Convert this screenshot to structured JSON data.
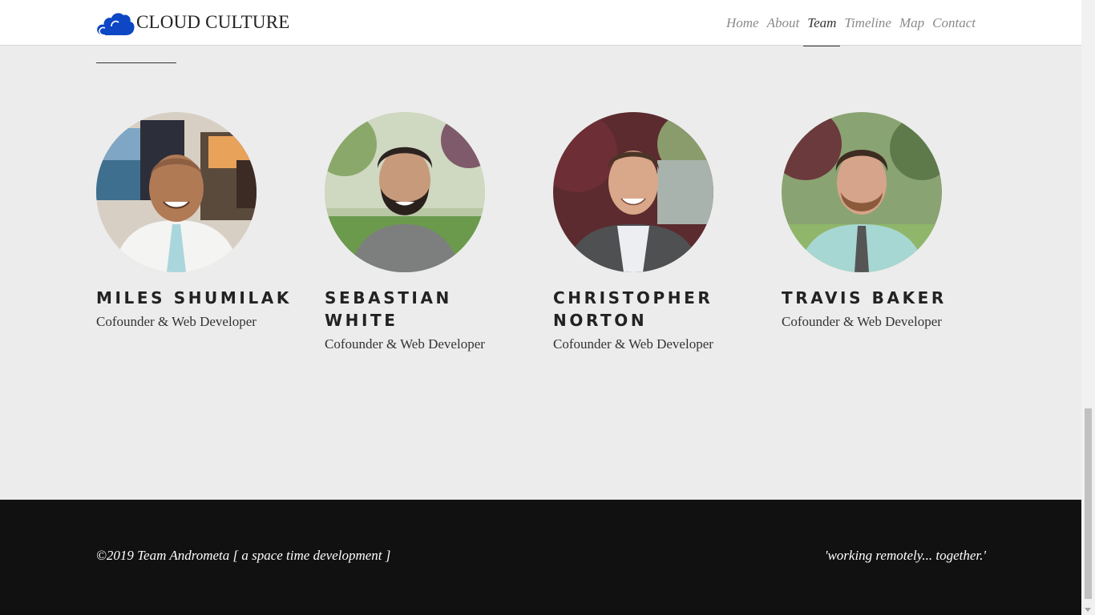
{
  "brand": {
    "name": "CLOUD CULTURE",
    "logo_icon": "cloud-icon",
    "logo_color": "#0d47c4"
  },
  "nav": {
    "items": [
      {
        "label": "Home",
        "active": false
      },
      {
        "label": "About",
        "active": false
      },
      {
        "label": "Team",
        "active": true
      },
      {
        "label": "Timeline",
        "active": false
      },
      {
        "label": "Map",
        "active": false
      },
      {
        "label": "Contact",
        "active": false
      }
    ]
  },
  "team": {
    "members": [
      {
        "name": "MILES SHUMILAK",
        "role": "Cofounder & Web Developer",
        "photo": "photo-miles"
      },
      {
        "name": "SEBASTIAN WHITE",
        "role": "Cofounder & Web Developer",
        "photo": "photo-sebastian"
      },
      {
        "name": "CHRISTOPHER NORTON",
        "role": "Cofounder & Web Developer",
        "photo": "photo-christopher"
      },
      {
        "name": "TRAVIS BAKER",
        "role": "Cofounder & Web Developer",
        "photo": "photo-travis"
      }
    ]
  },
  "footer": {
    "copyright": "©2019 Team Andrometa [ a space time development ]",
    "tagline": "'working remotely... together.'"
  },
  "colors": {
    "page_bg": "#ececec",
    "footer_bg": "#111111",
    "text_dark": "#222222"
  }
}
